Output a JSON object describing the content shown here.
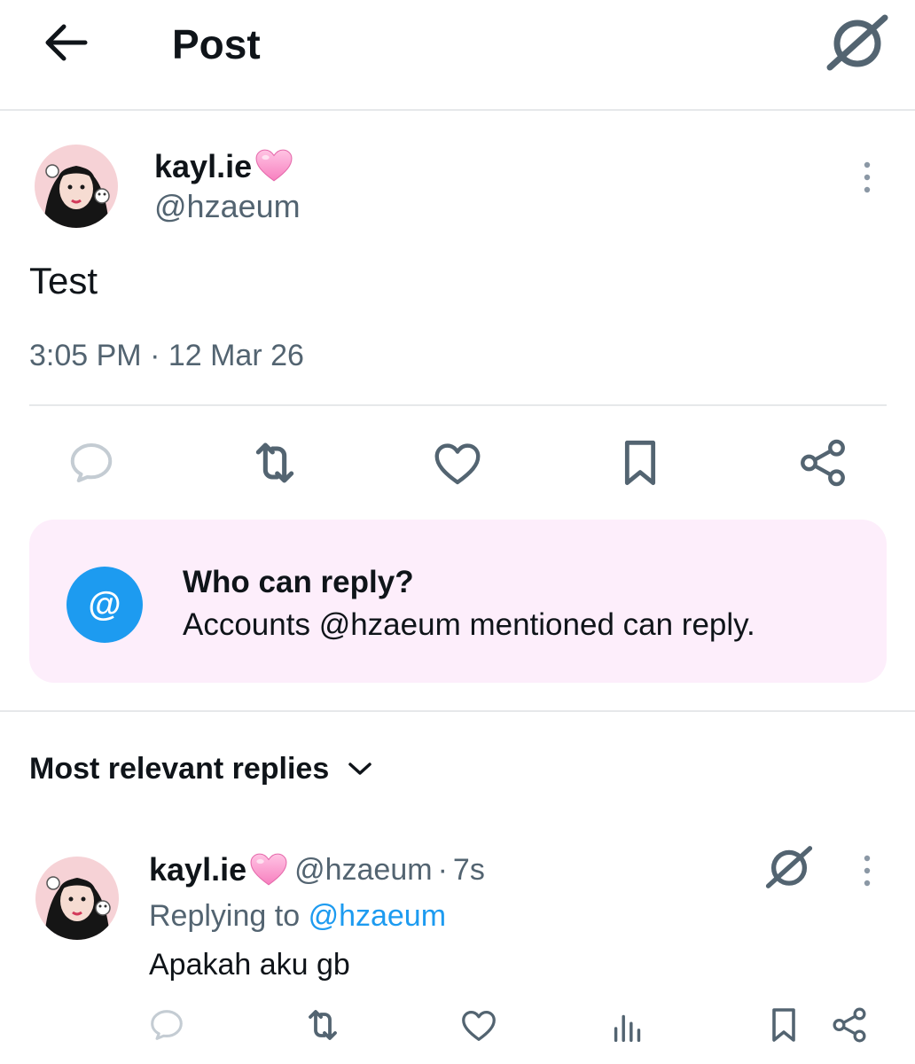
{
  "header": {
    "title": "Post",
    "back_icon": "arrow-left-icon",
    "grok_icon": "grok-icon"
  },
  "post": {
    "author": {
      "display_name": "kayl.ie",
      "badge_emoji": "pink-heart-icon",
      "handle": "@hzaeum"
    },
    "text": "Test",
    "timestamp": "3:05 PM · 12 Mar 26",
    "actions": [
      "reply-icon",
      "repost-icon",
      "like-icon",
      "bookmark-icon",
      "share-icon"
    ]
  },
  "who_can_reply": {
    "badge": "@",
    "title": "Who can reply?",
    "text": "Accounts @hzaeum mentioned can reply."
  },
  "replies_sort": {
    "label": "Most relevant replies"
  },
  "reply": {
    "display_name": "kayl.ie",
    "handle": "@hzaeum",
    "separator": "·",
    "age": "7s",
    "replying_prefix": "Replying to",
    "replying_to": "@hzaeum",
    "text": "Apakah aku gb",
    "actions": [
      "reply-icon",
      "repost-icon",
      "like-icon",
      "views-icon",
      "bookmark-icon",
      "share-icon"
    ]
  },
  "colors": {
    "text": "#0f1419",
    "muted": "#536471",
    "accent": "#1d9bf0",
    "card_bg": "#fdeefb",
    "divider": "#e6e8ea"
  }
}
